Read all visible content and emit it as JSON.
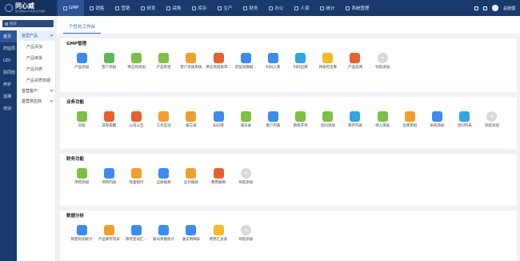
{
  "app": {
    "logo_name": "同心威",
    "logo_sub": "医疗器械GMP管理·生产服务"
  },
  "topnav": [
    {
      "label": "GMP",
      "active": true
    },
    {
      "label": "销售"
    },
    {
      "label": "营销"
    },
    {
      "label": "研发"
    },
    {
      "label": "采购"
    },
    {
      "label": "库存"
    },
    {
      "label": "生产"
    },
    {
      "label": "财务"
    },
    {
      "label": "办公"
    },
    {
      "label": "人资"
    },
    {
      "label": "统计"
    },
    {
      "label": "系统管理"
    }
  ],
  "topright": {
    "user": "总经理"
  },
  "sidebar": {
    "search_placeholder": "搜索",
    "rail": [
      {
        "label": "首页",
        "active": true
      },
      {
        "label": "药监局"
      },
      {
        "label": "UDI"
      },
      {
        "label": "协同检"
      },
      {
        "label": "养护"
      },
      {
        "label": "追溯"
      },
      {
        "label": "培训"
      }
    ],
    "groups": [
      {
        "label": "首营产品",
        "items": [
          "产品添加",
          "产品审批",
          "产品列表",
          "产品资质到期"
        ]
      },
      {
        "label": "首营客户",
        "items": []
      },
      {
        "label": "首营供应商",
        "items": []
      }
    ]
  },
  "tabs": [
    {
      "label": "个性化工作台"
    }
  ],
  "sections": [
    {
      "title": "GMP管理",
      "items": [
        {
          "label": "产品添加",
          "icon": "box",
          "color": "#3b8cf2"
        },
        {
          "label": "客户添加",
          "icon": "user-plus",
          "color": "#5cb85c"
        },
        {
          "label": "供应商添加",
          "icon": "handshake",
          "color": "#7cc142"
        },
        {
          "label": "产品审批",
          "icon": "stamp",
          "color": "#7cc142"
        },
        {
          "label": "客户资质审核",
          "icon": "id-card",
          "color": "#f0a02a"
        },
        {
          "label": "供应商资质审...",
          "icon": "doc-check",
          "color": "#e8612c"
        },
        {
          "label": "药监局数据...",
          "icon": "database",
          "color": "#3b8cf2"
        },
        {
          "label": "扫码入库",
          "icon": "scan-in",
          "color": "#3b8cf2"
        },
        {
          "label": "扫码出库",
          "icon": "scan-out",
          "color": "#2ba8e0"
        },
        {
          "label": "待质检出库",
          "icon": "check-box",
          "color": "#f5b922"
        },
        {
          "label": "产品追溯",
          "icon": "trace",
          "color": "#e8612c"
        },
        {
          "label": "导航添加",
          "icon": "add",
          "color": "#d9d9d9"
        }
      ]
    },
    {
      "title": "业务功能",
      "items": [
        {
          "label": "日程",
          "icon": "calendar",
          "color": "#7cc142"
        },
        {
          "label": "日程提醒",
          "icon": "alarm",
          "color": "#e8612c"
        },
        {
          "label": "公司公告",
          "icon": "megaphone",
          "color": "#e8612c"
        },
        {
          "label": "工作互动",
          "icon": "chat",
          "color": "#f0a02a"
        },
        {
          "label": "备忘录",
          "icon": "memo",
          "color": "#f0a02a"
        },
        {
          "label": "知识库",
          "icon": "book",
          "color": "#3b8cf2"
        },
        {
          "label": "通讯录",
          "icon": "contacts",
          "color": "#7cc142"
        },
        {
          "label": "客户列表",
          "icon": "customer",
          "color": "#3b8cf2"
        },
        {
          "label": "销售开单",
          "icon": "sales",
          "color": "#7cc142"
        },
        {
          "label": "合同添加",
          "icon": "contract",
          "color": "#7cc142"
        },
        {
          "label": "库存列表",
          "icon": "stock",
          "color": "#2ba8e0"
        },
        {
          "label": "待入库表",
          "icon": "inbound",
          "color": "#7cc142"
        },
        {
          "label": "出库审批",
          "icon": "outbound",
          "color": "#f0a02a"
        },
        {
          "label": "采购添加",
          "icon": "purchase",
          "color": "#3b8cf2"
        },
        {
          "label": "合同列表",
          "icon": "contract-list",
          "color": "#2ba8e0"
        },
        {
          "label": "导航添加",
          "icon": "add",
          "color": "#d9d9d9"
        }
      ]
    },
    {
      "title": "财务功能",
      "items": [
        {
          "label": "项目添加",
          "icon": "project",
          "color": "#7cc142"
        },
        {
          "label": "项目列表",
          "icon": "layers",
          "color": "#3b8cf2"
        },
        {
          "label": "现金银行",
          "icon": "cash",
          "color": "#f0a02a"
        },
        {
          "label": "应收账款",
          "icon": "receivable",
          "color": "#3b8cf2"
        },
        {
          "label": "应付账款",
          "icon": "payable",
          "color": "#f0a02a"
        },
        {
          "label": "费用报销",
          "icon": "expense",
          "color": "#e8612c"
        },
        {
          "label": "导航添加",
          "icon": "add",
          "color": "#d9d9d9"
        }
      ]
    },
    {
      "title": "数据分析",
      "items": [
        {
          "label": "销售利润统计",
          "icon": "bar-chart",
          "color": "#3b8cf2"
        },
        {
          "label": "产品库存列表",
          "icon": "stock-chart",
          "color": "#f0a02a"
        },
        {
          "label": "库存变动汇...",
          "icon": "pie-chart",
          "color": "#3b8cf2"
        },
        {
          "label": "账号余额统计",
          "icon": "balance",
          "color": "#3b8cf2"
        },
        {
          "label": "收支明细表",
          "icon": "line-chart",
          "color": "#3b8cf2"
        },
        {
          "label": "费用汇总表",
          "icon": "summary",
          "color": "#f5b922"
        },
        {
          "label": "导航添加",
          "icon": "add",
          "color": "#d9d9d9"
        }
      ]
    }
  ]
}
